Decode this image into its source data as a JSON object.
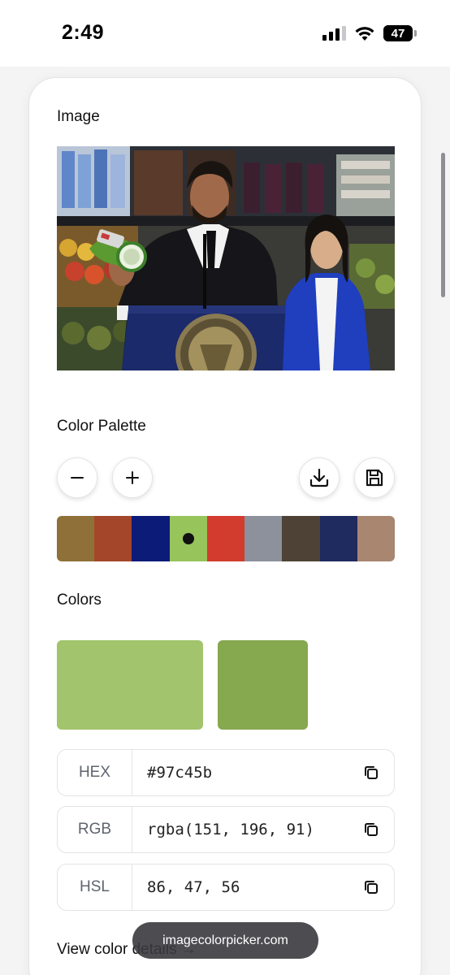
{
  "status_bar": {
    "time": "2:49",
    "battery": "47",
    "icons": [
      "cellular-signal-icon",
      "wifi-icon",
      "battery-icon"
    ]
  },
  "image_section": {
    "title": "Image"
  },
  "palette_section": {
    "title": "Color Palette",
    "buttons": [
      "minus-icon",
      "plus-icon",
      "download-icon",
      "save-icon"
    ],
    "colors": [
      "#8e7038",
      "#a4462a",
      "#0c1b78",
      "#97c45b",
      "#d23c2e",
      "#8c919c",
      "#4d4235",
      "#1f2a5f",
      "#a98670"
    ],
    "selected_index": 3
  },
  "colors_section": {
    "title": "Colors",
    "preview_primary": "#a2c46c",
    "preview_secondary": "#86a84e",
    "rows": [
      {
        "label": "HEX",
        "value": "#97c45b"
      },
      {
        "label": "RGB",
        "value": "rgba(151, 196, 91)"
      },
      {
        "label": "HSL",
        "value": "86, 47, 56"
      }
    ]
  },
  "view_link": {
    "label": "View color details",
    "arrow": "→"
  },
  "browser": {
    "url": "imagecolorpicker.com"
  }
}
